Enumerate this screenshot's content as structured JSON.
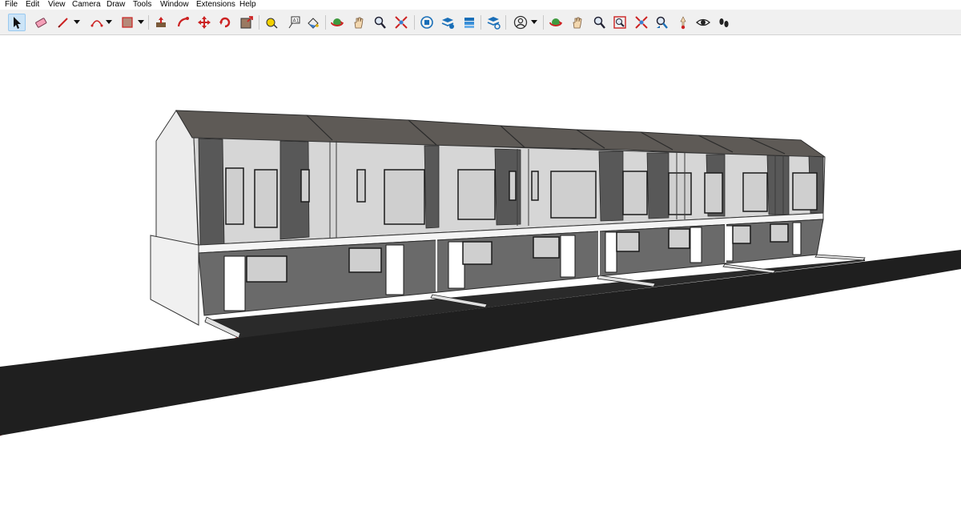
{
  "menubar": {
    "items": [
      {
        "label": "File"
      },
      {
        "label": "Edit"
      },
      {
        "label": "View"
      },
      {
        "label": "Camera"
      },
      {
        "label": "Draw"
      },
      {
        "label": "Tools"
      },
      {
        "label": "Window"
      },
      {
        "label": "Extensions"
      },
      {
        "label": "Help"
      }
    ]
  },
  "toolbar": {
    "active_tool": "select-tool",
    "tools": [
      {
        "icon": "select-arrow-icon",
        "active": true
      },
      {
        "icon": "eraser-icon"
      },
      {
        "icon": "pencil-line-icon",
        "dropdown": true
      },
      {
        "icon": "arc-icon",
        "dropdown": true
      },
      {
        "icon": "rectangle-shape-icon",
        "dropdown": true
      },
      {
        "icon": "push-pull-icon"
      },
      {
        "icon": "follow-me-icon"
      },
      {
        "icon": "move-icon"
      },
      {
        "icon": "rotate-icon"
      },
      {
        "icon": "scale-icon"
      },
      {
        "icon": "tape-measure-icon"
      },
      {
        "icon": "text-icon"
      },
      {
        "icon": "paint-bucket-icon"
      },
      {
        "icon": "orbit-icon"
      },
      {
        "icon": "pan-hand-icon"
      },
      {
        "icon": "zoom-icon"
      },
      {
        "icon": "zoom-extents-icon"
      },
      {
        "icon": "3d-warehouse-icon"
      },
      {
        "icon": "extension-warehouse-icon"
      },
      {
        "icon": "layout-icon"
      },
      {
        "icon": "extension-manager-icon"
      },
      {
        "icon": "account-icon",
        "dropdown": true
      },
      {
        "icon": "orbit-icon"
      },
      {
        "icon": "pan-hand-icon"
      },
      {
        "icon": "zoom-icon"
      },
      {
        "icon": "zoom-window-icon"
      },
      {
        "icon": "zoom-extents-icon"
      },
      {
        "icon": "previous-view-icon"
      },
      {
        "icon": "position-camera-icon"
      },
      {
        "icon": "look-around-eye-icon"
      },
      {
        "icon": "walk-footprints-icon"
      }
    ]
  },
  "scene": {
    "description_colors": {
      "road": "#1f1f1f",
      "roof": "#5e5a56",
      "wall_light": "#d6d6d6",
      "wall_side": "#ececec",
      "wall_dark": "#585858",
      "door": "#ffffff",
      "window_glass": "#cfcfcf",
      "red_axis": "#b02020"
    }
  }
}
